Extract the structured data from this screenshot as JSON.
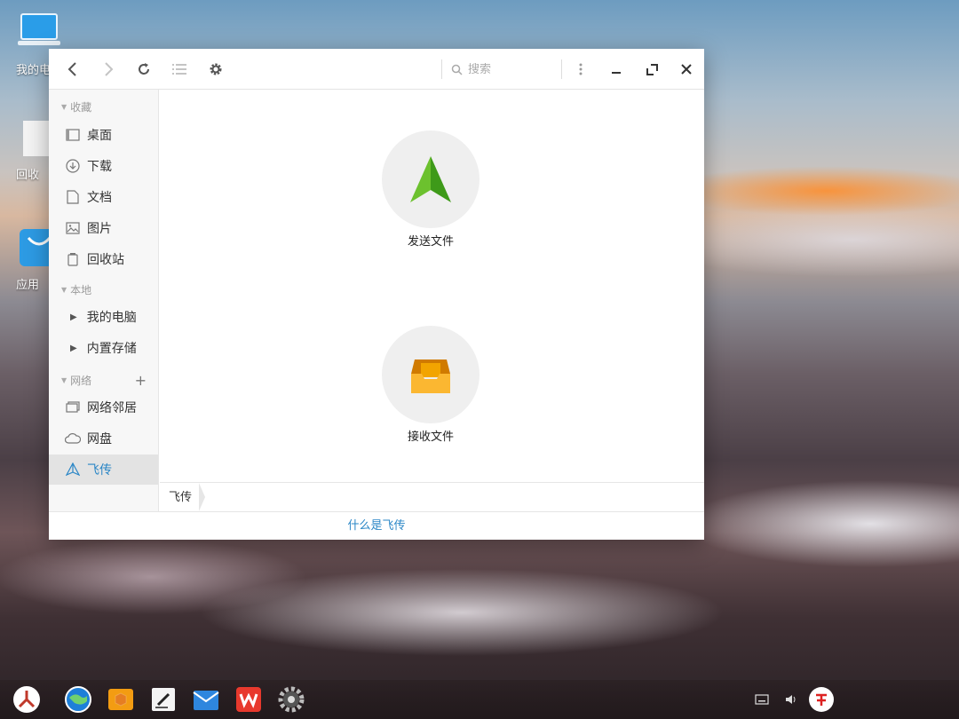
{
  "desktop": {
    "icons": [
      {
        "label": "我的电"
      },
      {
        "label": "回收"
      },
      {
        "label": "应用"
      }
    ]
  },
  "window": {
    "search": {
      "placeholder": "搜索"
    },
    "sidebar": {
      "favorites_header": "收藏",
      "favorites": [
        {
          "label": "桌面",
          "icon": "desktop-icon"
        },
        {
          "label": "下载",
          "icon": "download-icon"
        },
        {
          "label": "文档",
          "icon": "document-icon"
        },
        {
          "label": "图片",
          "icon": "picture-icon"
        },
        {
          "label": "回收站",
          "icon": "trash-icon"
        }
      ],
      "local_header": "本地",
      "local": [
        {
          "label": "我的电脑"
        },
        {
          "label": "内置存储"
        }
      ],
      "network_header": "网络",
      "network": [
        {
          "label": "网络邻居",
          "icon": "network-neighborhood-icon"
        },
        {
          "label": "网盘",
          "icon": "cloud-icon"
        },
        {
          "label": "飞传",
          "icon": "paper-plane-icon",
          "active": true
        }
      ]
    },
    "main": {
      "send_label": "发送文件",
      "receive_label": "接收文件"
    },
    "breadcrumb": [
      "飞传"
    ],
    "footer_link": "什么是飞传"
  },
  "colors": {
    "accent": "#2a86c6",
    "send_green": "#4caf1f",
    "receive_orange": "#f0a020"
  }
}
